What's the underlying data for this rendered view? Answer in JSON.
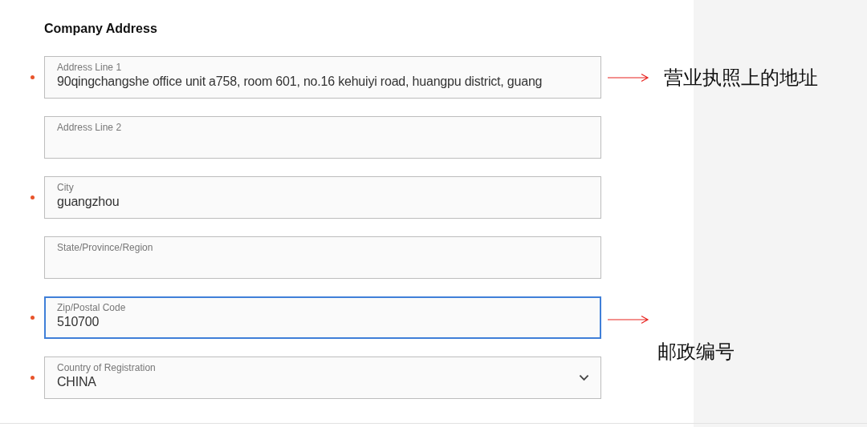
{
  "section": {
    "title": "Company Address"
  },
  "fields": [
    {
      "kind": "text",
      "label": "Address Line 1",
      "value": "90qingchangshe office unit a758, room 601, no.16 kehuiyi road, huangpu district, guang",
      "required": true,
      "focused": false,
      "annotation": {
        "text": "营业执照上的地址",
        "kind": "inline"
      }
    },
    {
      "kind": "text",
      "label": "Address Line 2",
      "required": false,
      "focused": false
    },
    {
      "kind": "text",
      "label": "City",
      "value": "guangzhou",
      "required": true,
      "focused": false
    },
    {
      "kind": "text",
      "label": "State/Province/Region",
      "required": false,
      "focused": false
    },
    {
      "kind": "text",
      "label": "Zip/Postal Code",
      "value": "510700",
      "required": true,
      "focused": true,
      "annotation": {
        "text": "邮政编号",
        "kind": "below"
      }
    },
    {
      "kind": "select",
      "label": "Country of Registration",
      "value": "CHINA",
      "required": true,
      "focused": false
    }
  ]
}
